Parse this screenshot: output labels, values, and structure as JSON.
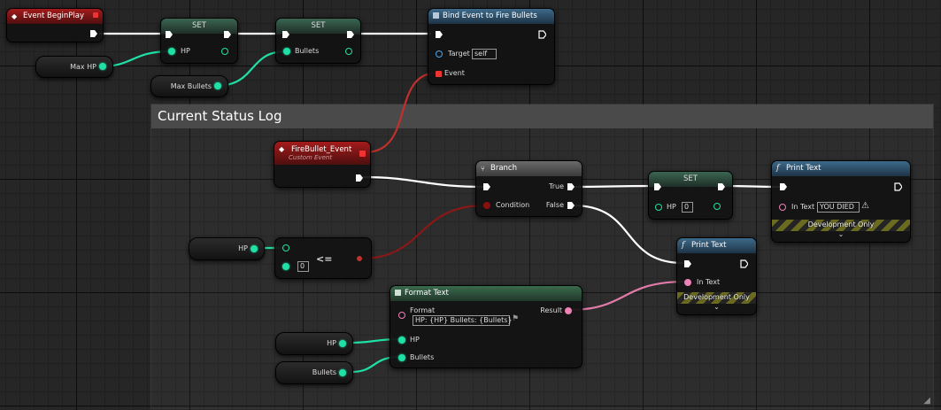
{
  "graph": {
    "comment_title": "Current Status Log",
    "colors": {
      "exec": "#ffffff",
      "float": "#1fe0a6",
      "string": "#f080b8",
      "bool": "#8a1010",
      "delegate": "#e33b3b"
    }
  },
  "nodes": {
    "begin_play": {
      "title": "Event BeginPlay"
    },
    "set1": {
      "title": "SET",
      "pin": "HP"
    },
    "set2": {
      "title": "SET",
      "pin": "Bullets"
    },
    "bind": {
      "title": "Bind Event to Fire Bullets",
      "target_label": "Target",
      "target_value": "self",
      "event_label": "Event"
    },
    "maxhp": {
      "label": "Max HP"
    },
    "maxbullets": {
      "label": "Max Bullets"
    },
    "firebullet": {
      "title": "FireBullet_Event",
      "subtitle": "Custom Event"
    },
    "branch": {
      "title": "Branch",
      "condition": "Condition",
      "true_label": "True",
      "false_label": "False"
    },
    "set3": {
      "title": "SET",
      "pin": "HP",
      "value": "0"
    },
    "print1": {
      "title": "Print Text",
      "in_text_label": "In Text",
      "in_text_value": "YOU DIED",
      "dev": "Development Only"
    },
    "print2": {
      "title": "Print Text",
      "in_text_label": "In Text",
      "dev": "Development Only"
    },
    "hp_get1": {
      "label": "HP"
    },
    "compare": {
      "op": "<=",
      "value": "0"
    },
    "format": {
      "title": "Format Text",
      "format_label": "Format",
      "format_value": "HP: {HP} Bullets: {Bullets}",
      "result_label": "Result",
      "hp_label": "HP",
      "bullets_label": "Bullets"
    },
    "hp_get2": {
      "label": "HP"
    },
    "bullets_get": {
      "label": "Bullets"
    }
  }
}
